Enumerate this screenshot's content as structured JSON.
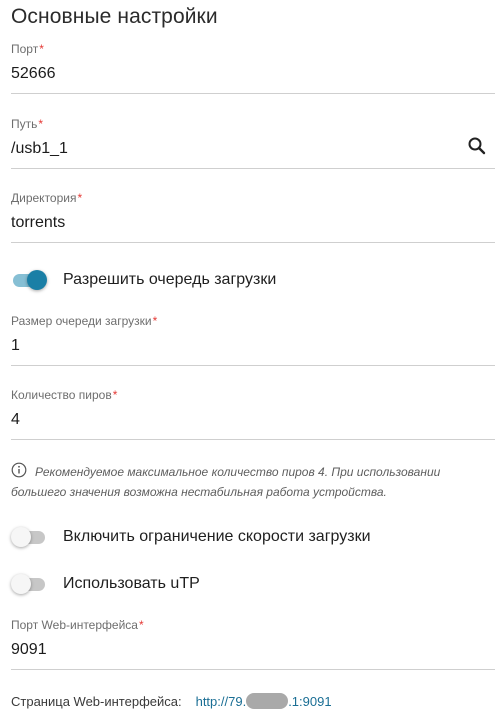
{
  "title": "Основные настройки",
  "fields": {
    "port": {
      "label": "Порт",
      "value": "52666"
    },
    "path": {
      "label": "Путь",
      "value": "/usb1_1"
    },
    "directory": {
      "label": "Директория",
      "value": "torrents"
    },
    "queue_size": {
      "label": "Размер очереди загрузки",
      "value": "1"
    },
    "peers": {
      "label": "Количество пиров",
      "value": "4"
    },
    "web_port": {
      "label": "Порт Web-интерфейса",
      "value": "9091"
    }
  },
  "required_mark": "*",
  "toggles": {
    "allow_queue": {
      "label": "Разрешить очередь загрузки",
      "state": "on"
    },
    "speed_limit": {
      "label": "Включить ограничение скорости загрузки",
      "state": "off"
    },
    "utp": {
      "label": "Использовать uTP",
      "state": "off"
    }
  },
  "info_text": "Рекомендуемое максимальное количество пиров 4. При использовании большего значения возможна нестабильная работа устройства.",
  "web_page": {
    "label": "Страница Web-интерфейса:",
    "link_prefix": "http://79.",
    "link_suffix": ".1:9091"
  },
  "colors": {
    "accent": "#1a7fa6",
    "required": "#e53935"
  },
  "icons": {
    "search": "search-icon",
    "info": "info-icon"
  }
}
